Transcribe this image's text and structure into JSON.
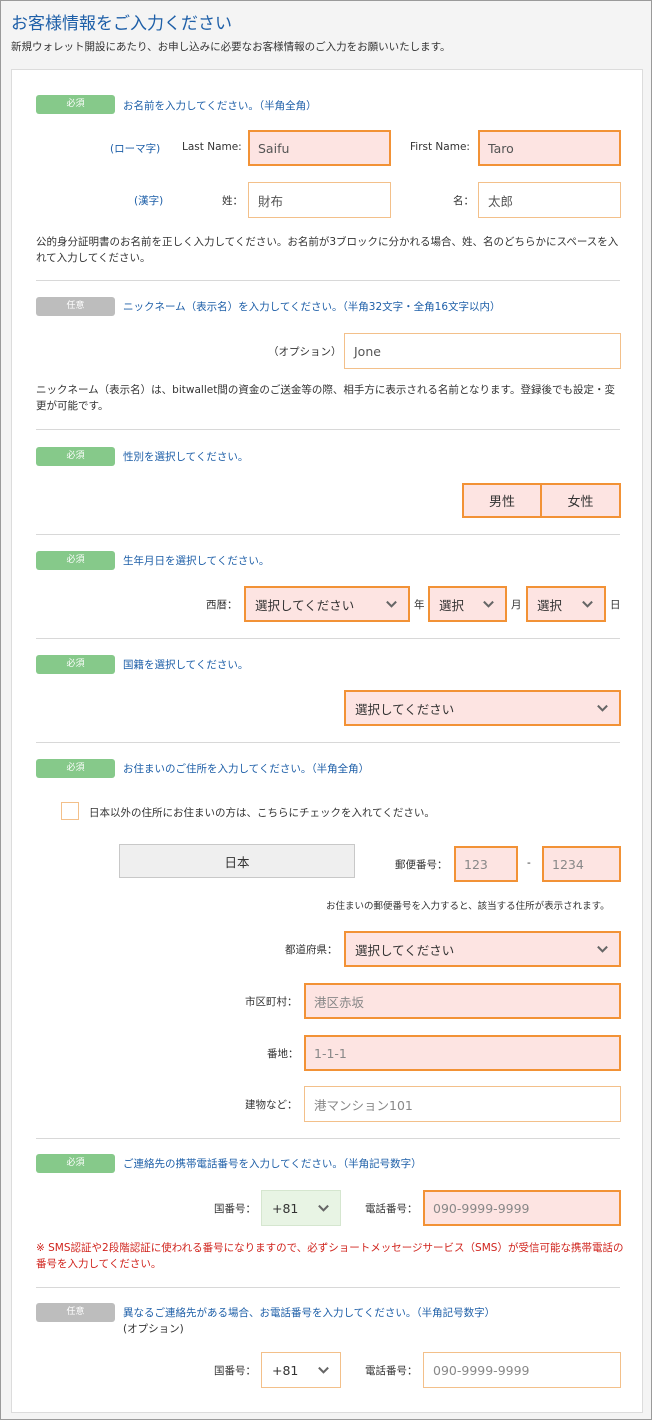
{
  "page": {
    "title": "お客様情報をご入力ください",
    "subtitle": "新規ウォレット開設にあたり、お申し込みに必要なお客様情報のご入力をお願いいたします。"
  },
  "badges": {
    "required": "必須",
    "optional": "任意"
  },
  "name": {
    "title": "お名前を入力してください。（半角全角）",
    "romaji_label": "(ローマ字)",
    "last_name_label": "Last Name:",
    "last_name_value": "Saifu",
    "first_name_label": "First Name:",
    "first_name_value": "Taro",
    "kanji_label": "(漢字)",
    "sei_label": "姓：",
    "sei_value": "財布",
    "mei_label": "名：",
    "mei_value": "太郎",
    "note": "公的身分証明書のお名前を正しく入力してください。お名前が3ブロックに分かれる場合、姓、名のどちらかにスペースを入れて入力してください。"
  },
  "nickname": {
    "title": "ニックネーム（表示名）を入力してください。（半角32文字・全角16文字以内）",
    "option_label": "（オプション）",
    "value": "Jone",
    "note": "ニックネーム（表示名）は、bitwallet間の資金のご送金等の際、相手方に表示される名前となります。登録後でも設定・変更が可能です。"
  },
  "gender": {
    "title": "性別を選択してください。",
    "male": "男性",
    "female": "女性"
  },
  "birth": {
    "title": "生年月日を選択してください。",
    "era_label": "西暦：",
    "year_value": "選択してください",
    "year_unit": "年",
    "month_value": "選択",
    "month_unit": "月",
    "day_value": "選択",
    "day_unit": "日"
  },
  "nationality": {
    "title": "国籍を選択してください。",
    "value": "選択してください"
  },
  "address": {
    "title": "お住まいのご住所を入力してください。（半角全角）",
    "overseas_check_label": "日本以外の住所にお住まいの方は、こちらにチェックを入れてください。",
    "country": "日本",
    "postal_label": "郵便番号：",
    "postal_1_placeholder": "123",
    "postal_dash": "-",
    "postal_2_placeholder": "1234",
    "postal_note": "お住まいの郵便番号を入力すると、該当する住所が表示されます。",
    "prefecture_label": "都道府県：",
    "prefecture_value": "選択してください",
    "city_label": "市区町村：",
    "city_placeholder": "港区赤坂",
    "street_label": "番地：",
    "street_placeholder": "1-1-1",
    "building_label": "建物など：",
    "building_placeholder": "港マンション101"
  },
  "mobile": {
    "title": "ご連絡先の携帯電話番号を入力してください。（半角記号数字）",
    "country_code_label": "国番号：",
    "country_code_value": "+81",
    "phone_label": "電話番号：",
    "phone_placeholder": "090-9999-9999",
    "warning": "※ SMS認証や2段階認証に使われる番号になりますので、必ずショートメッセージサービス（SMS）が受信可能な携帯電話の番号を入力してください。"
  },
  "other_phone": {
    "title": "異なるご連絡先がある場合、お電話番号を入力してください。（半角記号数字）",
    "option_label": "(オプション)",
    "country_code_label": "国番号：",
    "country_code_value": "+81",
    "phone_label": "電話番号：",
    "phone_placeholder": "090-9999-9999"
  },
  "icons": {
    "dropdown": "chevron-down-icon",
    "checkbox": "checkbox-icon"
  },
  "colors": {
    "accent_blue": "#1e5fa8",
    "required_green": "#86c98a",
    "optional_gray": "#bdbdbd",
    "input_border": "#f29236",
    "input_fill": "#fde4e2",
    "warning_red": "#d0231c"
  }
}
